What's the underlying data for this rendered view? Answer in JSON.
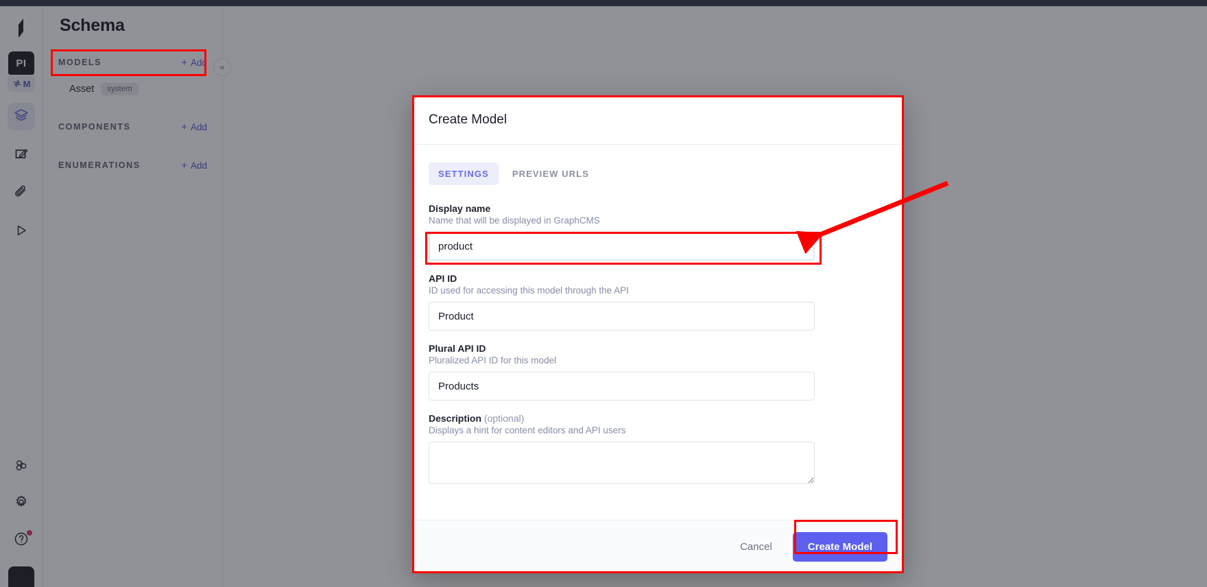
{
  "app": {
    "name": "GraphCMS",
    "logo_icon": "graphcms-logo-icon"
  },
  "rail": {
    "project_badge": "PI",
    "project_switcher": "M",
    "project_switcher_icon": "switch-project-icon",
    "items": [
      {
        "name": "schema",
        "icon": "layers-icon",
        "active": true
      },
      {
        "name": "content",
        "icon": "edit-square-icon",
        "active": false
      },
      {
        "name": "assets",
        "icon": "paperclip-icon",
        "active": false
      },
      {
        "name": "api-playground",
        "icon": "play-triangle-icon",
        "active": false
      }
    ],
    "bottom_items": [
      {
        "name": "webhooks",
        "icon": "webhook-icon"
      },
      {
        "name": "settings",
        "icon": "gear-icon"
      },
      {
        "name": "help",
        "icon": "question-circle-icon",
        "has_notification": true
      }
    ],
    "avatar": "user-avatar"
  },
  "sidebar": {
    "title": "Schema",
    "collapse_icon": "chevron-double-left-icon",
    "sections": [
      {
        "label": "MODELS",
        "add_label": "Add",
        "items": [
          {
            "name": "Asset",
            "badge": "system"
          }
        ]
      },
      {
        "label": "COMPONENTS",
        "add_label": "Add",
        "items": []
      },
      {
        "label": "ENUMERATIONS",
        "add_label": "Add",
        "items": []
      }
    ]
  },
  "modal": {
    "title": "Create Model",
    "tabs": [
      {
        "label": "SETTINGS",
        "active": true
      },
      {
        "label": "PREVIEW URLS",
        "active": false
      }
    ],
    "fields": {
      "display_name": {
        "label": "Display name",
        "hint": "Name that will be displayed in GraphCMS",
        "value": "product",
        "placeholder": ""
      },
      "api_id": {
        "label": "API ID",
        "hint": "ID used for accessing this model through the API",
        "value": "Product",
        "placeholder": ""
      },
      "plural_api_id": {
        "label": "Plural API ID",
        "hint": "Pluralized API ID for this model",
        "value": "Products",
        "placeholder": ""
      },
      "description": {
        "label": "Description",
        "optional_tag": "(optional)",
        "hint": "Displays a hint for content editors and API users",
        "value": "",
        "placeholder": ""
      }
    },
    "footer": {
      "cancel_label": "Cancel",
      "submit_label": "Create Model"
    }
  },
  "colors": {
    "accent": "#5d5fef",
    "accent_soft": "#edeefb",
    "annotation": "#fb0000",
    "topbar": "#2f3545",
    "badge_dot": "#d9336b"
  }
}
